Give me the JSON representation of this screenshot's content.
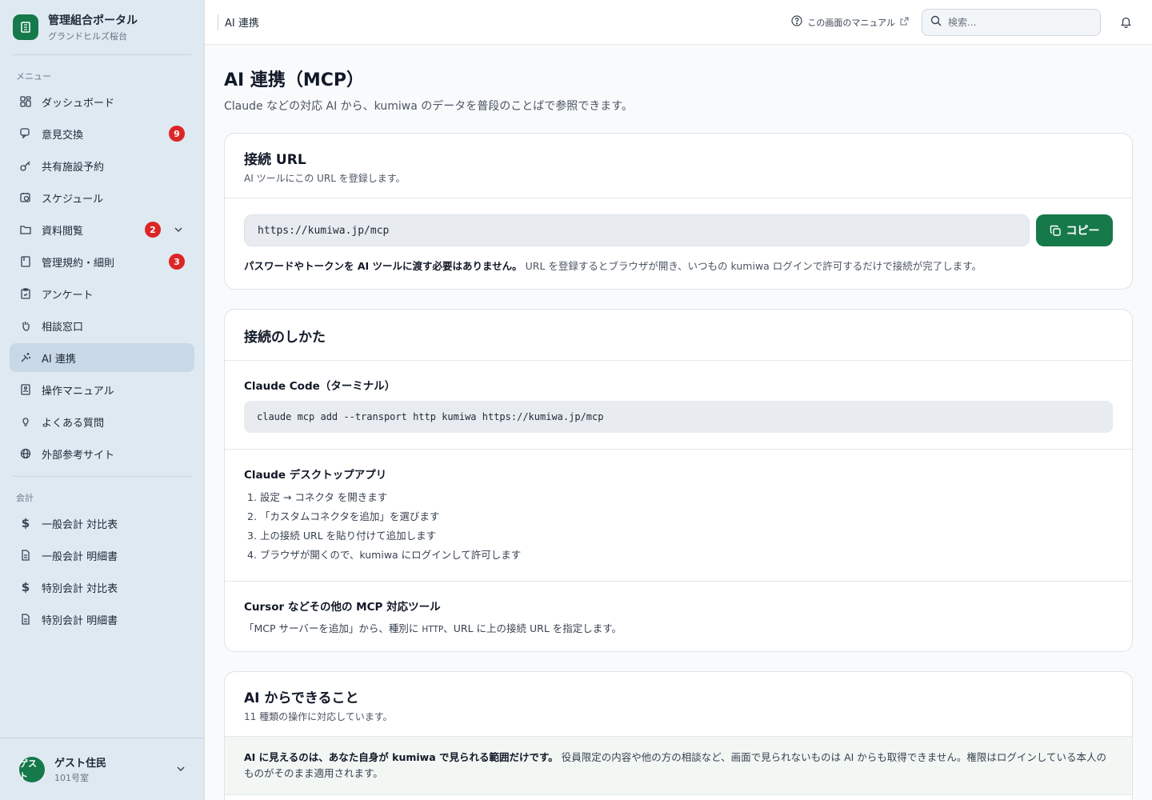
{
  "brand": {
    "title": "管理組合ポータル",
    "subtitle": "グランドヒルズ桜台"
  },
  "sidebar": {
    "menu_label": "メニュー",
    "items": [
      {
        "label": "ダッシュボード",
        "icon": "dashboard-icon"
      },
      {
        "label": "意見交換",
        "icon": "chat-icon",
        "badge": "9"
      },
      {
        "label": "共有施設予約",
        "icon": "key-icon"
      },
      {
        "label": "スケジュール",
        "icon": "calendar-clock-icon"
      },
      {
        "label": "資料閲覧",
        "icon": "folder-icon",
        "badge": "2"
      },
      {
        "label": "管理規約・細則",
        "icon": "book-icon",
        "badge": "3"
      },
      {
        "label": "アンケート",
        "icon": "clipboard-icon"
      },
      {
        "label": "相談窓口",
        "icon": "hand-icon"
      },
      {
        "label": "AI 連携",
        "icon": "sparkle-plug-icon"
      },
      {
        "label": "操作マニュアル",
        "icon": "manual-icon"
      },
      {
        "label": "よくある質問",
        "icon": "lightbulb-icon"
      },
      {
        "label": "外部参考サイト",
        "icon": "globe-icon"
      }
    ],
    "accounting_label": "会計",
    "accounting_items": [
      {
        "label": "一般会計 対比表",
        "icon": "dollar-icon"
      },
      {
        "label": "一般会計 明細書",
        "icon": "document-icon"
      },
      {
        "label": "特別会計 対比表",
        "icon": "dollar-icon"
      },
      {
        "label": "特別会計 明細書",
        "icon": "document-icon"
      }
    ]
  },
  "user": {
    "avatar": "ゲスト",
    "name": "ゲスト住民",
    "room": "101号室"
  },
  "topbar": {
    "breadcrumb": "AI 連携",
    "manual_link": "この画面のマニュアル",
    "search_placeholder": "検索..."
  },
  "page": {
    "title": "AI 連携（MCP）",
    "subtitle": "Claude などの対応 AI から、kumiwa のデータを普段のことばで参照できます。"
  },
  "connection": {
    "title": "接続 URL",
    "desc": "AI ツールにこの URL を登録します。",
    "url": "https://kumiwa.jp/mcp",
    "copy_label": "コピー",
    "note_bold": "パスワードやトークンを AI ツールに渡す必要はありません。",
    "note_rest": "URL を登録するとブラウザが開き、いつもの kumiwa ログインで許可するだけで接続が完了します。"
  },
  "howto": {
    "title": "接続のしかた",
    "claude_code_title": "Claude Code（ターミナル）",
    "claude_code_cmd": "claude mcp add --transport http kumiwa https://kumiwa.jp/mcp",
    "desktop_title": "Claude デスクトップアプリ",
    "desktop_steps": [
      "1. 設定 → コネクタ を開きます",
      "2. 「カスタムコネクタを追加」を選びます",
      "3. 上の接続 URL を貼り付けて追加します",
      "4. ブラウザが開くので、kumiwa にログインして許可します"
    ],
    "other_title": "Cursor などその他の MCP 対応ツール",
    "other_text_1": "「MCP サーバーを追加」から、種別に",
    "other_text_http": "HTTP",
    "other_text_2": "、URL に上の接続 URL を指定します。"
  },
  "capabilities": {
    "title": "AI からできること",
    "desc": "11 種類の操作に対応しています。",
    "notice_bold": "AI に見えるのは、あなた自身が kumiwa で見られる範囲だけです。",
    "notice_rest": "役員限定の内容や他の方の相談など、画面で見られないものは AI からも取得できません。権限はログインしている本人のものがそのまま適用されます。"
  },
  "colors": {
    "accent": "#16794a",
    "badge": "#dc2626",
    "sidebar": "#dfe9f2"
  }
}
